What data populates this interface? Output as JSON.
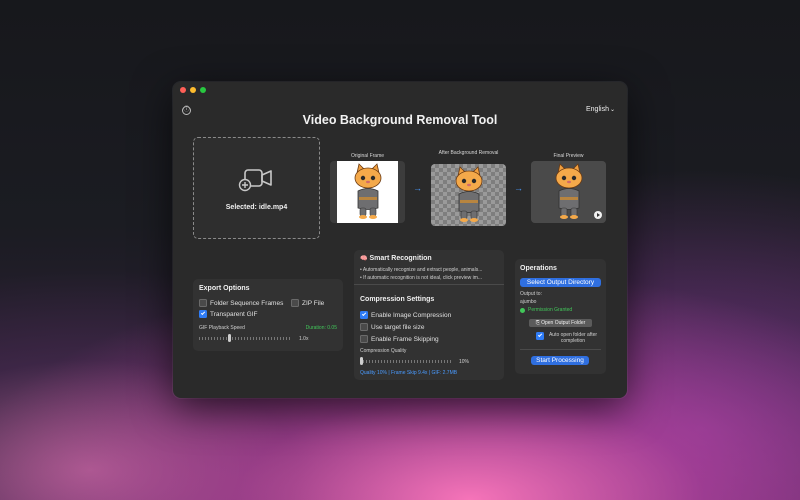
{
  "window": {
    "title": "Video Background Removal Tool",
    "language": "English",
    "language_chevron": "⌄",
    "info_icon": "ⓘ"
  },
  "dropzone": {
    "label": "Selected: idle.mp4"
  },
  "frames": {
    "original": "Original Frame",
    "after_bg": "After Background Removal",
    "final": "Final Preview"
  },
  "export": {
    "title": "Export Options",
    "folder_frames": "Folder Sequence Frames",
    "zip": "ZIP File",
    "gif": "Transparent GIF",
    "speed_label": "GIF Playback Speed",
    "duration": "Duration: 0.05",
    "speed_value": "1.0x",
    "speed_fraction": 0.33,
    "folder_frames_checked": false,
    "zip_checked": false,
    "gif_checked": true
  },
  "smart": {
    "icon": "🧠",
    "title": "Smart Recognition",
    "line1": "• Automatically recognize and extract people, animals...",
    "line2": "• If automatic recognition is not ideal, click preview im..."
  },
  "compression": {
    "title": "Compression Settings",
    "enable_compression": "Enable Image Compression",
    "target_size": "Use target file size",
    "frame_skip": "Enable Frame Skipping",
    "quality_label": "Compression Quality",
    "quality_value": "10%",
    "quality_fraction": 0.0,
    "summary": "Quality 10% | Frame Skip 9.4x | GIF: 2.7MB",
    "enable_compression_checked": true,
    "target_size_checked": false,
    "frame_skip_checked": false
  },
  "operations": {
    "title": "Operations",
    "select_dir": "Select Output Directory",
    "output_to": "Output to:",
    "path": "ajumbo",
    "permission": "Permission Granted",
    "open_folder": "Open Output Folder",
    "auto_open": "Auto open folder after completion",
    "auto_open_checked": true,
    "start": "Start Processing"
  },
  "colors": {
    "accent": "#2f6fe0",
    "success": "#42c75a",
    "info": "#4a9bff"
  }
}
